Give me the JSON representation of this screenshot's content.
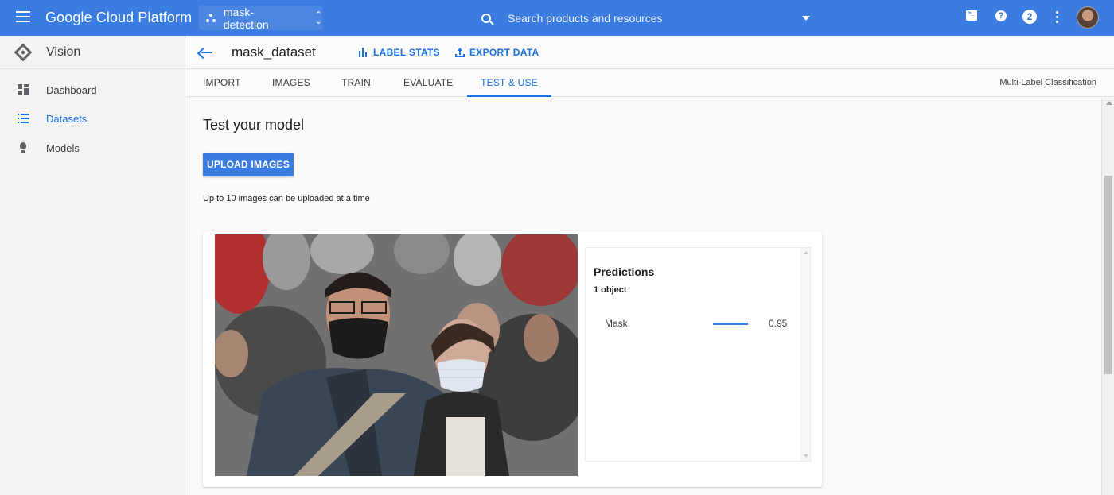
{
  "app": {
    "brand": "Google Cloud Platform",
    "project": "mask-detection",
    "search_placeholder": "Search products and resources",
    "notification_count": "2"
  },
  "sidebar": {
    "product": "Vision",
    "items": [
      {
        "label": "Dashboard",
        "icon": "dashboard-icon",
        "active": false
      },
      {
        "label": "Datasets",
        "icon": "list-icon",
        "active": true
      },
      {
        "label": "Models",
        "icon": "lightbulb-icon",
        "active": false
      }
    ]
  },
  "header": {
    "title": "mask_dataset",
    "label_stats": "LABEL STATS",
    "export_data": "EXPORT DATA"
  },
  "tabs": [
    {
      "label": "IMPORT",
      "active": false
    },
    {
      "label": "IMAGES",
      "active": false
    },
    {
      "label": "TRAIN",
      "active": false
    },
    {
      "label": "EVALUATE",
      "active": false
    },
    {
      "label": "TEST & USE",
      "active": true
    }
  ],
  "mode": "Multi-Label Classification",
  "main": {
    "title": "Test your model",
    "upload_button": "UPLOAD IMAGES",
    "hint": "Up to 10 images can be uploaded at a time"
  },
  "predictions": {
    "title": "Predictions",
    "count": "1 object",
    "items": [
      {
        "label": "Mask",
        "score": "0.95",
        "score_value": 0.95
      }
    ]
  },
  "colors": {
    "topbar": "#3b7ce0",
    "accent": "#1a73e8"
  }
}
